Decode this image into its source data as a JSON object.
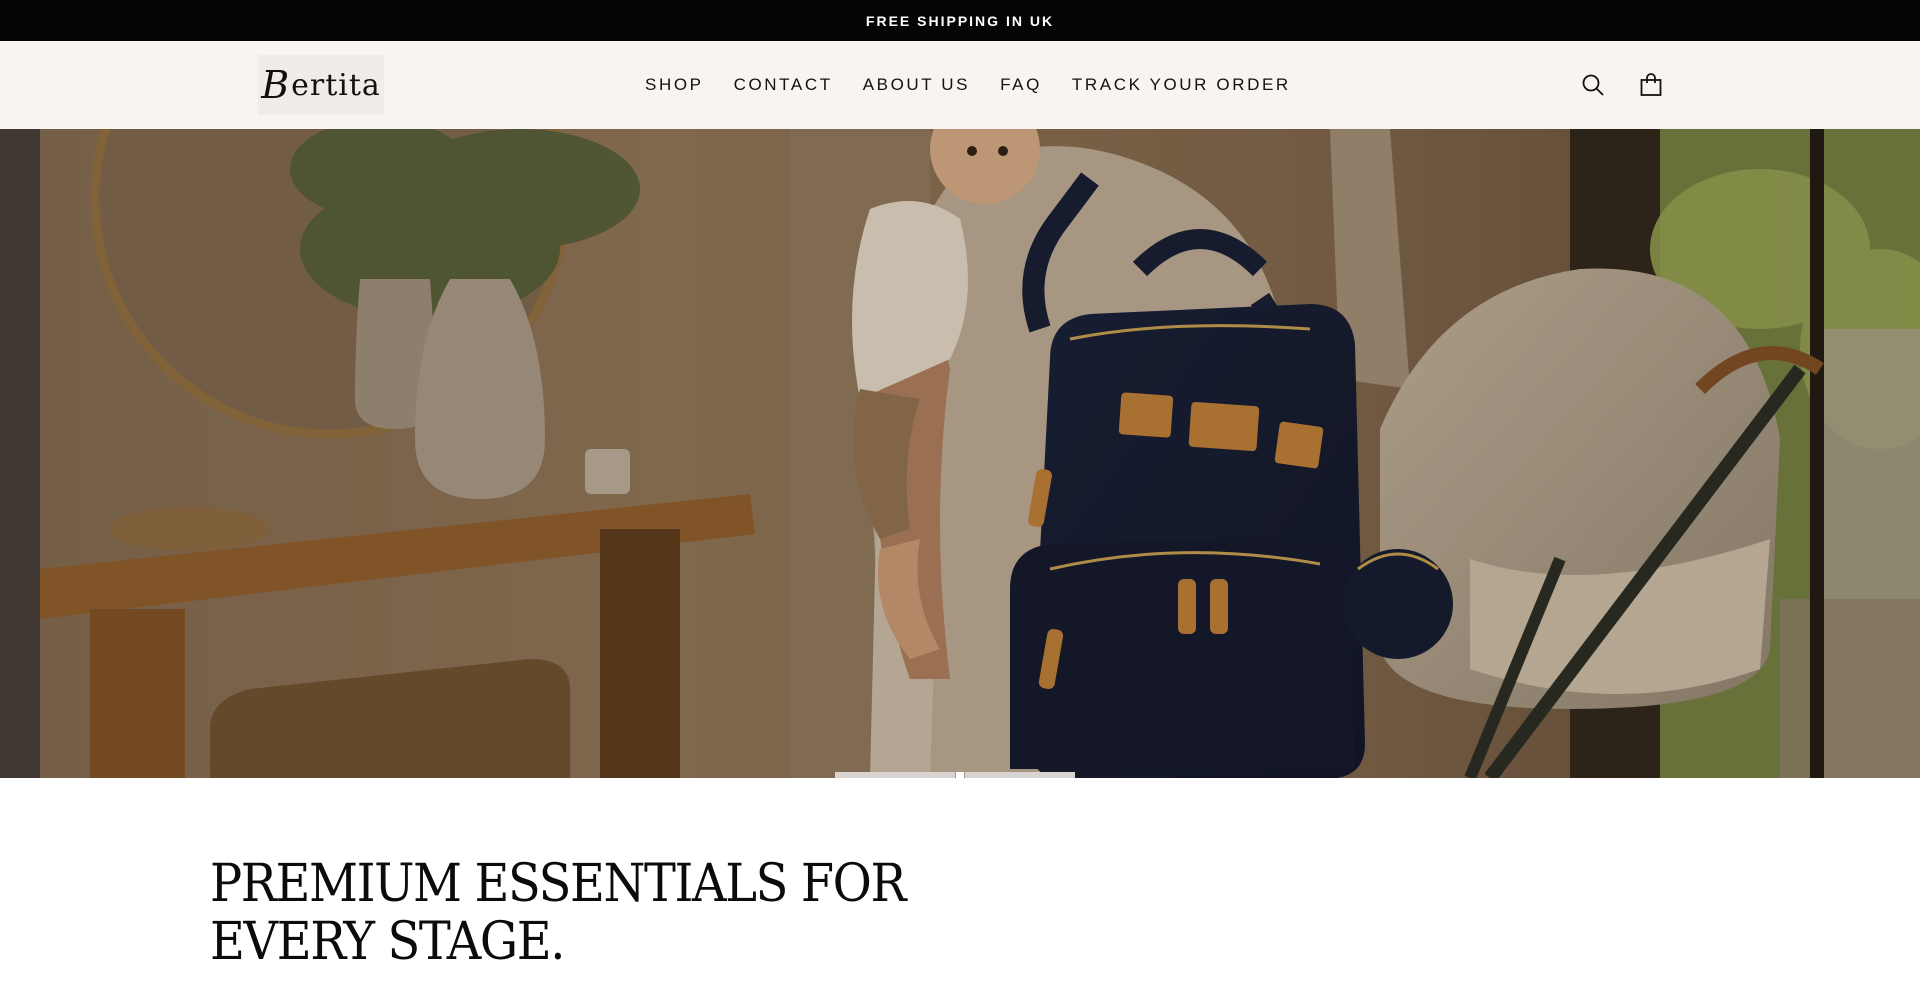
{
  "announcement": {
    "text": "FREE SHIPPING IN UK"
  },
  "header": {
    "logo_first": "B",
    "logo_rest": "ertita",
    "nav": [
      {
        "label": "SHOP"
      },
      {
        "label": "CONTACT"
      },
      {
        "label": "ABOUT US"
      },
      {
        "label": "FAQ"
      },
      {
        "label": "TRACK YOUR ORDER"
      }
    ],
    "icons": {
      "search": "search-icon",
      "cart": "shopping-bag-icon"
    }
  },
  "hero": {
    "slides": 2,
    "active_slide": 1
  },
  "content": {
    "headline_line1": "PREMIUM ESSENTIALS FOR",
    "headline_line2": "EVERY STAGE."
  },
  "colors": {
    "announcement_bg": "#050505",
    "header_bg": "#f8f4f1",
    "backpack_navy": "#101a33",
    "tan_accent": "#c07a2c"
  }
}
